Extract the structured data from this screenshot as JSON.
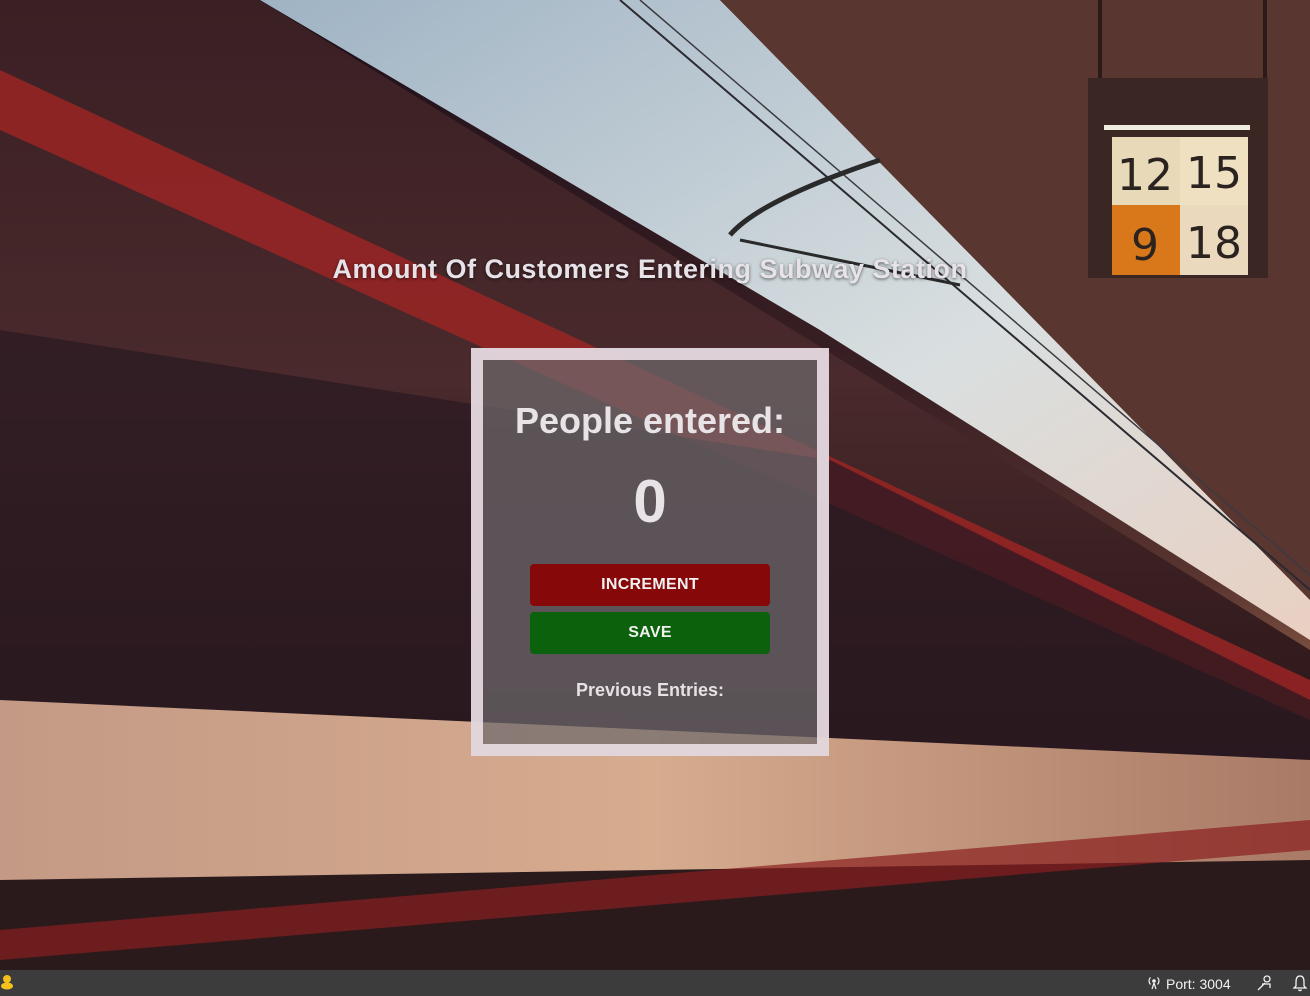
{
  "page": {
    "heading": "Amount Of Customers Entering Subway Station"
  },
  "counter": {
    "title": "People entered:",
    "value": "0",
    "increment_label": "INCREMENT",
    "save_label": "SAVE",
    "previous_label": "Previous Entries:"
  },
  "status_bar": {
    "port_label": "Port: 3004",
    "icons": [
      "broadcast-icon",
      "feedback-icon",
      "bell-icon"
    ]
  },
  "colors": {
    "increment": "#870808",
    "save": "#0c620c",
    "status_bar": "#3c3c3c"
  }
}
